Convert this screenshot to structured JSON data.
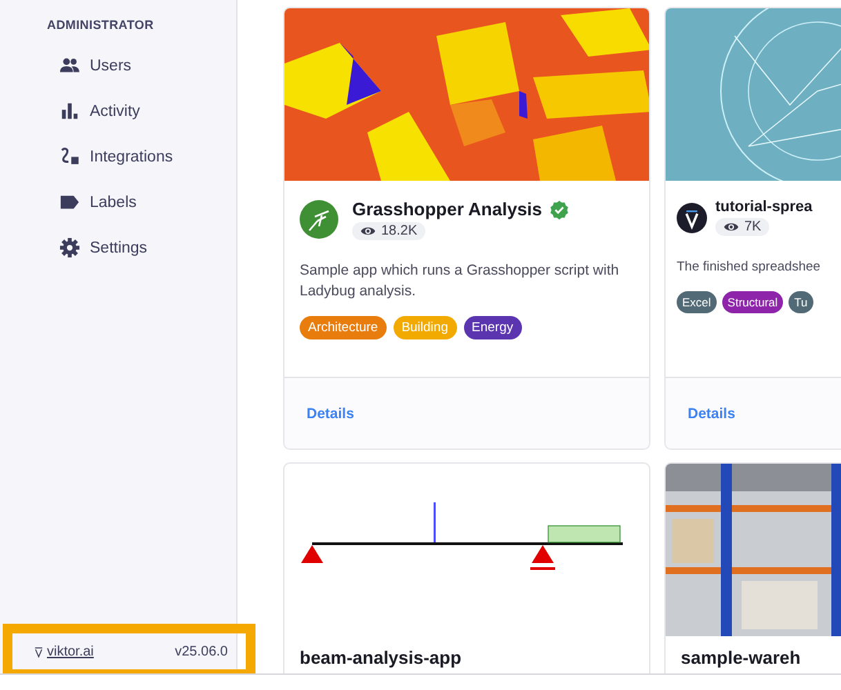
{
  "sidebar": {
    "section_title": "ADMINISTRATOR",
    "items": [
      {
        "label": "Users",
        "kind": "users"
      },
      {
        "label": "Activity",
        "kind": "activity"
      },
      {
        "label": "Integrations",
        "kind": "integrations"
      },
      {
        "label": "Labels",
        "kind": "labels"
      },
      {
        "label": "Settings",
        "kind": "settings"
      }
    ],
    "footer": {
      "link": "viktor.ai",
      "version": "v25.06.0"
    }
  },
  "apps": [
    {
      "title": "Grasshopper Analysis",
      "views": "18.2K",
      "verified": true,
      "kind": "grasshopper",
      "description": "Sample app which runs a Grasshopper script with Ladybug analysis.",
      "tags": [
        {
          "label": "Architecture",
          "color": "#e87d0d"
        },
        {
          "label": "Building",
          "color": "#f2a900"
        },
        {
          "label": "Energy",
          "color": "#5b35b0"
        }
      ],
      "action": "Details"
    },
    {
      "title": "tutorial-sprea",
      "views": "7K",
      "verified": false,
      "kind": "logo",
      "description": "The finished spreadshee",
      "tags": [
        {
          "label": "Excel",
          "color": "#526a75"
        },
        {
          "label": "Structural",
          "color": "#8e24aa"
        },
        {
          "label": "Tu",
          "color": "#526a75"
        }
      ],
      "action": "Details"
    },
    {
      "title": "beam-analysis-app"
    },
    {
      "title": "sample-wareh"
    }
  ]
}
